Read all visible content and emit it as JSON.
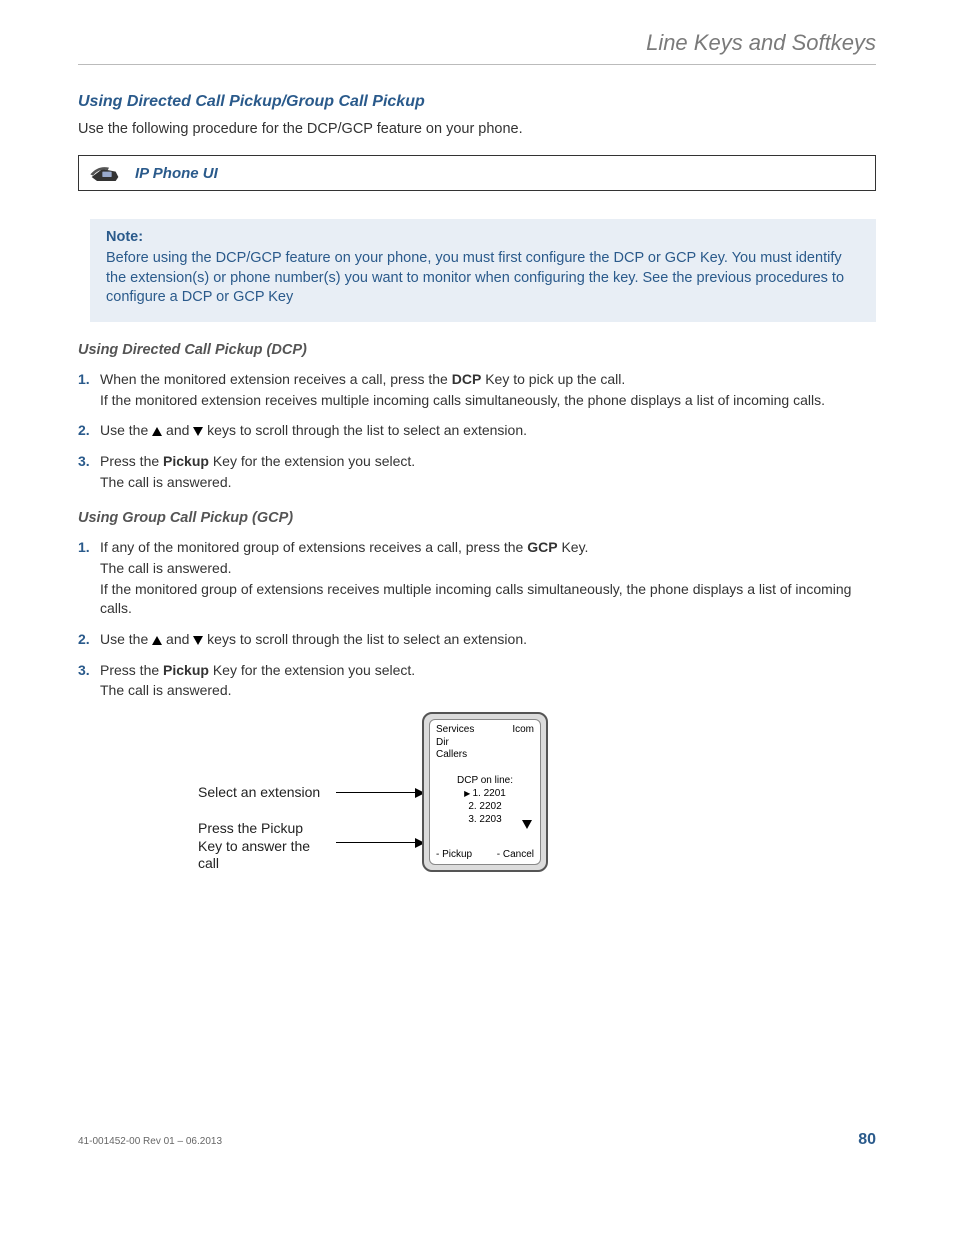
{
  "header": {
    "title": "Line Keys and Softkeys"
  },
  "section": {
    "heading": "Using Directed Call Pickup/Group Call Pickup",
    "intro": "Use the following procedure for the DCP/GCP feature on your phone."
  },
  "uibox": {
    "label": "IP Phone UI"
  },
  "note": {
    "title": "Note:",
    "body": "Before using the DCP/GCP feature on your phone, you must first configure the DCP or GCP Key. You must identify the extension(s) or phone number(s) you want to monitor when configuring the key. See the previous procedures to configure a DCP or GCP Key"
  },
  "dcp": {
    "heading": "Using Directed Call Pickup (DCP)",
    "steps": {
      "s1a_pre": "When the monitored extension receives a call, press the ",
      "s1a_bold": "DCP",
      "s1a_post": " Key to pick up the call.",
      "s1b": "If the monitored extension receives multiple incoming calls simultaneously, the phone displays a list of incoming calls.",
      "s2_pre": "Use the ",
      "s2_mid": " and ",
      "s2_post": " keys to scroll through the list to select an extension.",
      "s3a_pre": "Press the ",
      "s3a_bold": "Pickup",
      "s3a_post": " Key for the extension you select.",
      "s3b": "The call is answered."
    }
  },
  "gcp": {
    "heading": "Using Group Call Pickup (GCP)",
    "steps": {
      "s1a_pre": "If any of the monitored group of extensions receives a call, press the ",
      "s1a_bold": "GCP",
      "s1a_post": " Key.",
      "s1b": "The call is answered.",
      "s1c": "If the monitored group of extensions receives multiple incoming calls simultaneously, the phone displays a list of incoming calls.",
      "s2_pre": "Use the ",
      "s2_mid": " and ",
      "s2_post": " keys to scroll through the list to select an extension.",
      "s3a_pre": "Press the ",
      "s3a_bold": "Pickup",
      "s3a_post": " Key for the extension you select.",
      "s3b": "The call is answered."
    }
  },
  "diagram": {
    "label1": "Select an extension",
    "label2": "Press the Pickup Key to answer the call",
    "screen": {
      "topleft1": "Services",
      "topleft2": "Dir",
      "topleft3": "Callers",
      "topright": "Icom",
      "mid_title": "DCP on line:",
      "mid1": "1. 2201",
      "mid2": "2. 2202",
      "mid3": "3. 2203",
      "bl": "- Pickup",
      "br": "- Cancel"
    }
  },
  "footer": {
    "rev": "41-001452-00 Rev 01 – 06.2013",
    "page": "80"
  }
}
